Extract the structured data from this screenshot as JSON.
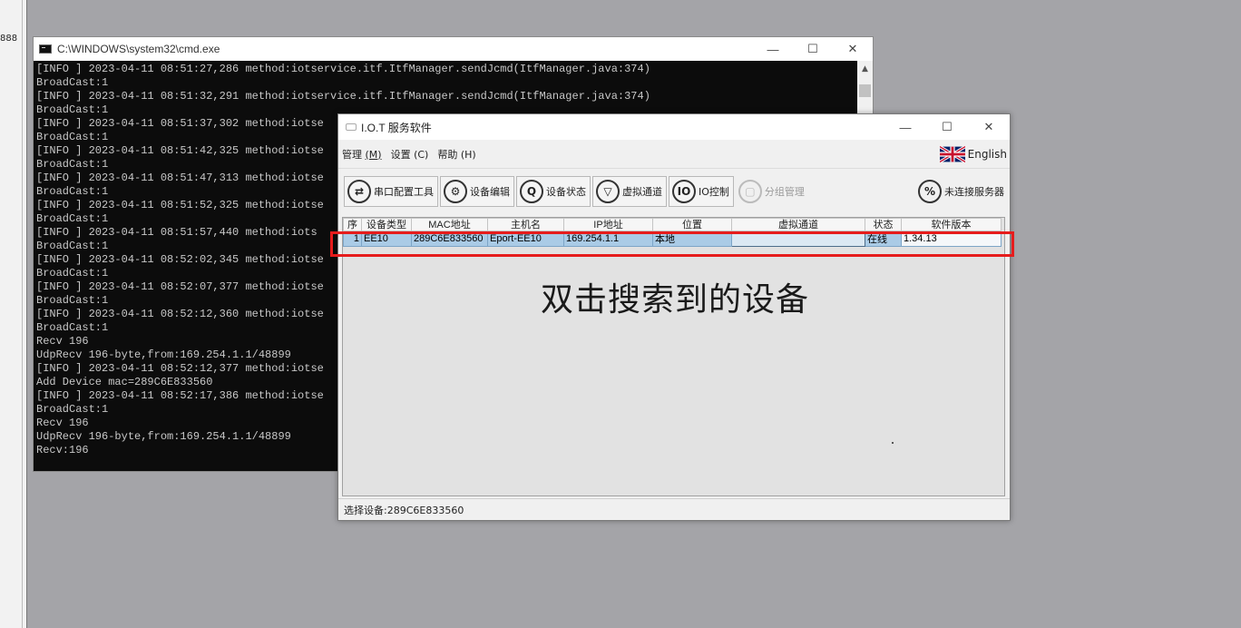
{
  "left_strip": {
    "number": "888"
  },
  "cmd": {
    "title": "C:\\WINDOWS\\system32\\cmd.exe",
    "min": "—",
    "max": "☐",
    "close": "✕",
    "lines": [
      "[INFO ] 2023-04-11 08:51:27,286 method:iotservice.itf.ItfManager.sendJcmd(ItfManager.java:374)",
      "BroadCast:1",
      "[INFO ] 2023-04-11 08:51:32,291 method:iotservice.itf.ItfManager.sendJcmd(ItfManager.java:374)",
      "BroadCast:1",
      "[INFO ] 2023-04-11 08:51:37,302 method:iotse",
      "BroadCast:1",
      "[INFO ] 2023-04-11 08:51:42,325 method:iotse",
      "BroadCast:1",
      "[INFO ] 2023-04-11 08:51:47,313 method:iotse",
      "BroadCast:1",
      "[INFO ] 2023-04-11 08:51:52,325 method:iotse",
      "BroadCast:1",
      "[INFO ] 2023-04-11 08:51:57,440 method:iots",
      "BroadCast:1",
      "[INFO ] 2023-04-11 08:52:02,345 method:iotse",
      "BroadCast:1",
      "[INFO ] 2023-04-11 08:52:07,377 method:iotse",
      "BroadCast:1",
      "[INFO ] 2023-04-11 08:52:12,360 method:iotse",
      "BroadCast:1",
      "Recv 196",
      "UdpRecv 196-byte,from:169.254.1.1/48899",
      "[INFO ] 2023-04-11 08:52:12,377 method:iotse",
      "Add Device mac=289C6E833560",
      "[INFO ] 2023-04-11 08:52:17,386 method:iotse",
      "BroadCast:1",
      "Recv 196",
      "UdpRecv 196-byte,from:169.254.1.1/48899",
      "Recv:196"
    ]
  },
  "iot": {
    "title": "I.O.T 服务软件",
    "min": "—",
    "max": "☐",
    "close": "✕",
    "menu": {
      "manage": "管理",
      "manage_key": "(M)",
      "settings": "设置 (C)",
      "help": "帮助 (H)"
    },
    "language": "English",
    "toolbar": {
      "serial_config": "串口配置工具",
      "device_edit": "设备编辑",
      "device_status": "设备状态",
      "virtual_channel": "虚拟通道",
      "io_control": "IO控制",
      "io_icon": "IO",
      "group_manage": "分组管理",
      "server_status": "未连接服务器"
    },
    "table": {
      "headers": [
        "序",
        "设备类型",
        "MAC地址",
        "主机名",
        "IP地址",
        "位置",
        "虚拟通道",
        "状态",
        "软件版本"
      ],
      "rows": [
        [
          "1",
          "EE10",
          "289C6E833560",
          "Eport-EE10",
          "169.254.1.1",
          "本地",
          "",
          "在线",
          "1.34.13"
        ]
      ]
    },
    "overlay": "双击搜索到的设备",
    "status": "选择设备:289C6E833560"
  },
  "colors": {
    "highlight": "#e61c1c",
    "row_selected": "#aacbe6"
  }
}
